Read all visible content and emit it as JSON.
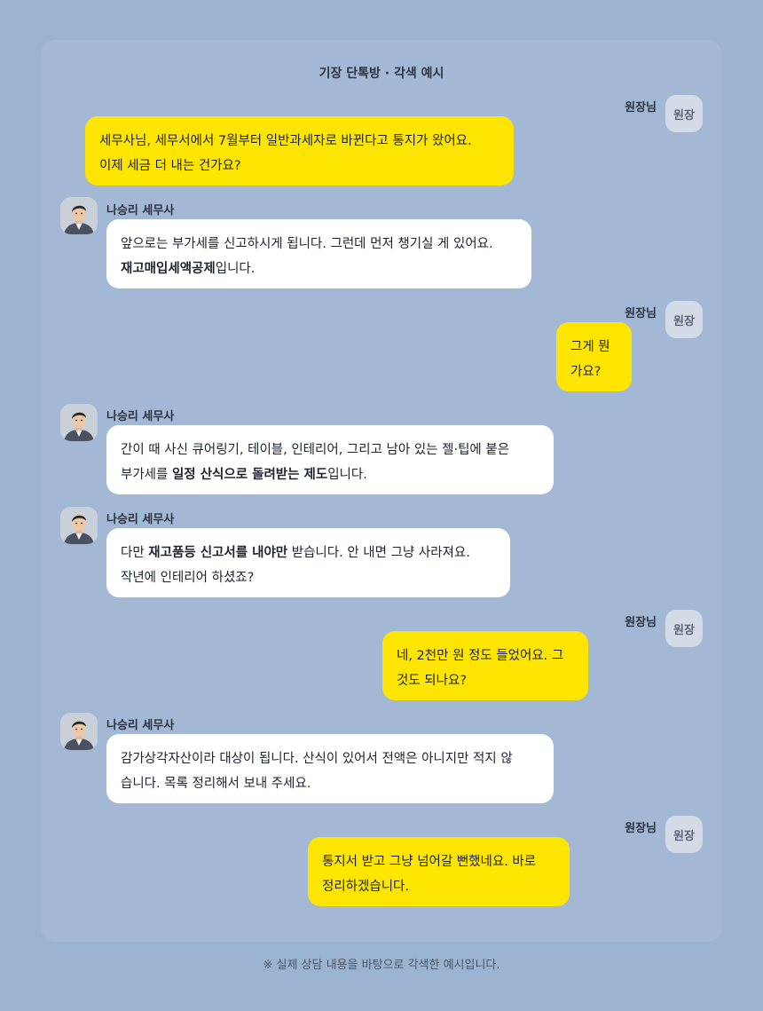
{
  "chat": {
    "title": "기장 단톡방 · 각색 예시",
    "me_name": "원장님",
    "me_avatar_label": "원장",
    "pro_name": "나승리 세무사",
    "colors": {
      "page_bg": "#9bb3d0",
      "panel_bg": "#a3b8d4",
      "my_bubble": "#fee500",
      "pro_bubble": "#ffffff"
    },
    "messages": [
      {
        "sender": "me",
        "lines": [
          [
            {
              "t": "세무사님, 세무서에서 7월부터 일반과세자로 바뀐다고 통지가 왔어요."
            }
          ],
          [
            {
              "t": "이제 세금 더 내는 건가요?"
            }
          ]
        ]
      },
      {
        "sender": "pro",
        "lines": [
          [
            {
              "t": "앞으로는 부가세를 신고하시게 됩니다. 그런데 먼저 챙기실 게 있어요."
            }
          ],
          [
            {
              "t": "재고매입세액공제",
              "b": true
            },
            {
              "t": "입니다."
            }
          ]
        ]
      },
      {
        "sender": "me",
        "lines": [
          [
            {
              "t": "그게 뭔"
            }
          ],
          [
            {
              "t": "가요?"
            }
          ]
        ]
      },
      {
        "sender": "pro",
        "lines": [
          [
            {
              "t": "간이 때 사신 큐어링기, 테이블, 인테리어, 그리고 남아 있는 젤·팁에 붙은"
            }
          ],
          [
            {
              "t": "부가세를 "
            },
            {
              "t": "일정 산식으로 돌려받는 제도",
              "b": true
            },
            {
              "t": "입니다."
            }
          ]
        ]
      },
      {
        "sender": "pro",
        "lines": [
          [
            {
              "t": "다만 "
            },
            {
              "t": "재고품등 신고서를 내야만",
              "b": true
            },
            {
              "t": " 받습니다. 안 내면 그냥 사라져요."
            }
          ],
          [
            {
              "t": "작년에 인테리어 하셨죠?"
            }
          ]
        ]
      },
      {
        "sender": "me",
        "lines": [
          [
            {
              "t": "네, 2천만 원 정도 들었어요. 그"
            }
          ],
          [
            {
              "t": "것도 되나요?"
            }
          ]
        ]
      },
      {
        "sender": "pro",
        "lines": [
          [
            {
              "t": "감가상각자산이라 대상이 됩니다. 산식이 있어서 전액은 아니지만 적지 않"
            }
          ],
          [
            {
              "t": "습니다. 목록 정리해서 보내 주세요."
            }
          ]
        ]
      },
      {
        "sender": "me",
        "lines": [
          [
            {
              "t": "통지서 받고 그냥 넘어갈 뻔했네요. 바로"
            }
          ],
          [
            {
              "t": "정리하겠습니다."
            }
          ]
        ]
      }
    ]
  },
  "footnote": "※ 실제 상담 내용을 바탕으로 각색한 예시입니다."
}
